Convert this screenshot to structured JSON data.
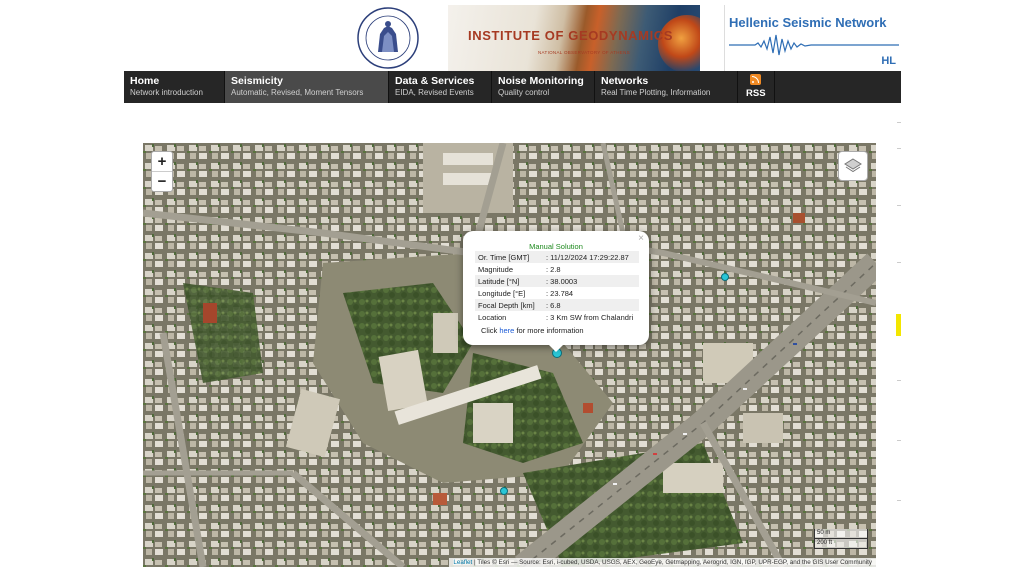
{
  "header": {
    "institute_title": "INSTITUTE OF GEODYNAMICS",
    "institute_subtitle": "NATIONAL OBSERVATORY OF ATHENS",
    "network_title": "Hellenic Seismic Network",
    "network_code": "HL"
  },
  "nav": {
    "items": [
      {
        "label": "Home",
        "sub": "Network introduction"
      },
      {
        "label": "Seismicity",
        "sub": "Automatic, Revised, Moment Tensors"
      },
      {
        "label": "Data & Services",
        "sub": "EIDA, Revised Events"
      },
      {
        "label": "Noise Monitoring",
        "sub": "Quality control"
      },
      {
        "label": "Networks",
        "sub": "Real Time Plotting, Information"
      }
    ],
    "rss": "RSS"
  },
  "map": {
    "zoom_in": "+",
    "zoom_out": "−",
    "popup": {
      "close": "×",
      "title": "Manual Solution",
      "rows": [
        {
          "key": "Or. Time [GMT]",
          "value": ": 11/12/2024 17:29:22.87"
        },
        {
          "key": "Magnitude",
          "value": ": 2.8"
        },
        {
          "key": "Latitude [°N]",
          "value": ": 38.0003"
        },
        {
          "key": "Longitude [°E]",
          "value": ": 23.784"
        },
        {
          "key": "Focal Depth [km]",
          "value": ": 6.8"
        },
        {
          "key": "Location",
          "value": ": 3 Km SW from Chalandri"
        }
      ],
      "click_prefix": "Click ",
      "click_link": "here",
      "click_suffix": " for more information"
    },
    "scale_top": "50 m",
    "scale_bottom": "200 ft",
    "attribution_link": "Leaflet",
    "attribution_text": " | Tiles © Esri — Source: Esri, i-cubed, USDA, USGS, AEX, GeoEye, Getmapping, Aerogrid, IGN, IGP, UPR-EGP, and the GIS User Community",
    "marker_color": "#29c6d6"
  }
}
